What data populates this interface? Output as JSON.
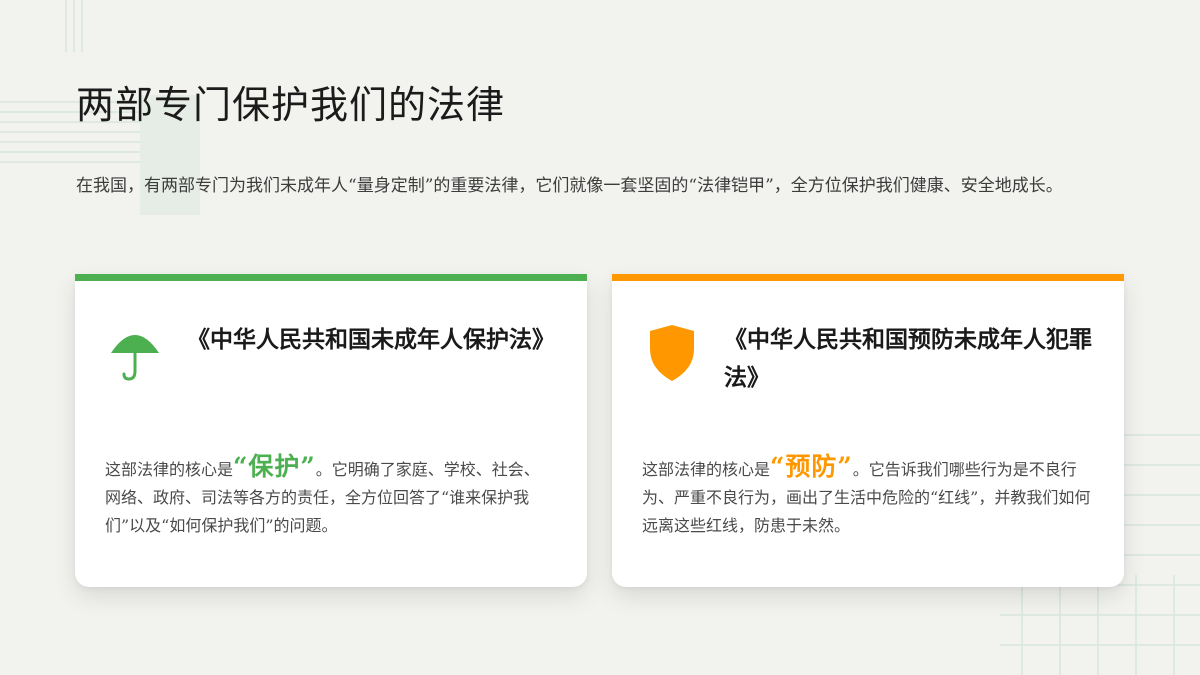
{
  "page": {
    "title": "两部专门保护我们的法律",
    "intro": "在我国，有两部专门为我们未成年人“量身定制”的重要法律，它们就像一套坚固的“法律铠甲”，全方位保护我们健康、安全地成长。"
  },
  "colors": {
    "green": "#4caf50",
    "orange": "#ff9800"
  },
  "cards": [
    {
      "icon": "umbrella-icon",
      "title": "《中华人民共和国未成年人保护法》",
      "body_prefix": "这部法律的核心是",
      "highlight": "“保护”",
      "body_suffix": "。它明确了家庭、学校、社会、网络、政府、司法等各方的责任，全方位回答了“谁来保护我们”以及“如何保护我们”的问题。"
    },
    {
      "icon": "shield-icon",
      "title": "《中华人民共和国预防未成年人犯罪法》",
      "body_prefix": "这部法律的核心是",
      "highlight": "“预防”",
      "body_suffix": "。它告诉我们哪些行为是不良行为、严重不良行为，画出了生活中危险的“红线”，并教我们如何远离这些红线，防患于未然。"
    }
  ]
}
